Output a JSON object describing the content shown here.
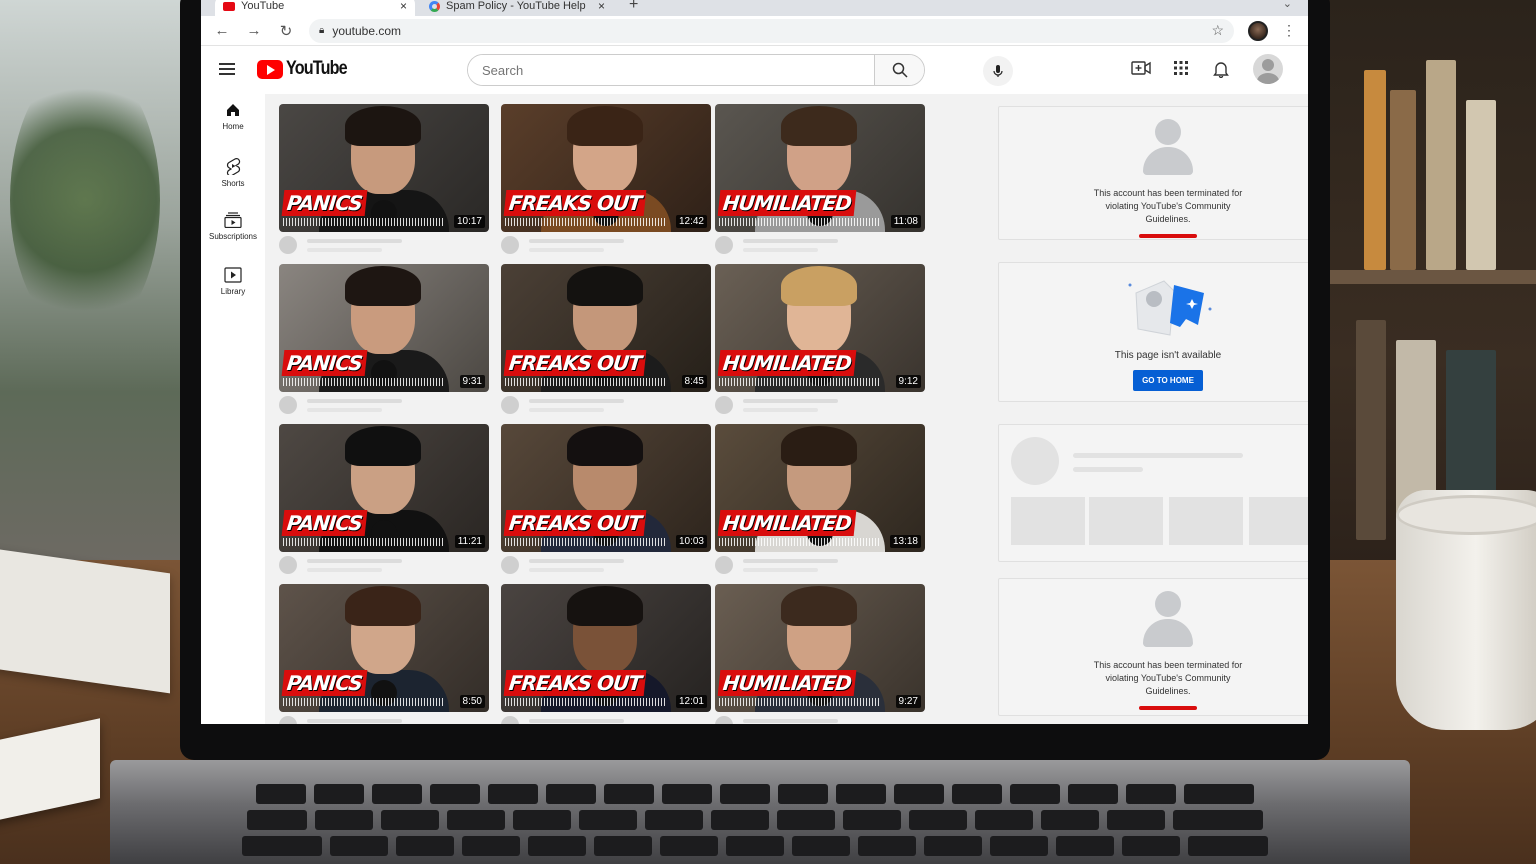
{
  "browser": {
    "tabs": [
      {
        "title": "YouTube",
        "active": true
      },
      {
        "title": "Spam Policy - YouTube Help",
        "active": false
      }
    ],
    "url": "youtube.com"
  },
  "youtube": {
    "logo_text": "YouTube",
    "search_placeholder": "Search",
    "sidebar": [
      {
        "label": "Home",
        "icon": "home-icon"
      },
      {
        "label": "Shorts",
        "icon": "shorts-icon"
      },
      {
        "label": "Subscriptions",
        "icon": "subscriptions-icon"
      },
      {
        "label": "Library",
        "icon": "library-icon"
      }
    ],
    "videos": [
      {
        "caption": "PANICS",
        "duration": "10:17"
      },
      {
        "caption": "FREAKS OUT",
        "duration": "12:42"
      },
      {
        "caption": "HUMILIATED",
        "duration": "11:08"
      },
      {
        "caption": "PANICS",
        "duration": "9:31"
      },
      {
        "caption": "FREAKS OUT",
        "duration": "8:45"
      },
      {
        "caption": "HUMILIATED",
        "duration": "9:12"
      },
      {
        "caption": "PANICS",
        "duration": "11:21"
      },
      {
        "caption": "FREAKS OUT",
        "duration": "10:03"
      },
      {
        "caption": "HUMILIATED",
        "duration": "13:18"
      },
      {
        "caption": "PANICS",
        "duration": "8:50"
      },
      {
        "caption": "FREAKS OUT",
        "duration": "12:01"
      },
      {
        "caption": "HUMILIATED",
        "duration": "9:27"
      }
    ],
    "panels": {
      "terminated_text": "This account has been terminated for violating YouTube's Community Guidelines.",
      "unavailable_text": "This page isn't available",
      "go_home_label": "GO TO HOME"
    }
  },
  "colors": {
    "accent_red": "#d90d0d",
    "youtube_red": "#ff0000",
    "button_blue": "#065fd4"
  }
}
